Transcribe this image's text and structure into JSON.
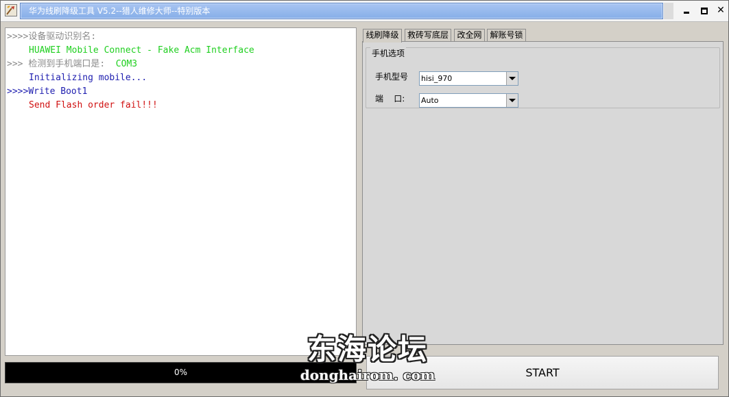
{
  "window": {
    "title": "华为线刷降级工具 V5.2--猎人维修大师--特别版本"
  },
  "log": {
    "lines": [
      {
        "prefix": ">>>>",
        "text": "设备驱动识别名:"
      },
      {
        "text": "HUAWEI Mobile Connect - Fake Acm Interface"
      },
      {
        "prefix": ">>> ",
        "text": "检测到手机端口是:",
        "value": "COM3"
      },
      {
        "text": "Initializing mobile..."
      },
      {
        "prefix": ">>>>",
        "text": "Write Boot1"
      },
      {
        "text": "Send Flash order fail!!!"
      }
    ]
  },
  "progress": {
    "label": "0%",
    "value": 0
  },
  "tabs": [
    {
      "label": "线刷降级"
    },
    {
      "label": "救砖写底层"
    },
    {
      "label": "改全网"
    },
    {
      "label": "解账号锁"
    }
  ],
  "phone_options": {
    "group_title": "手机选项",
    "model_label": "手机型号",
    "model_value": "hisi_970",
    "port_label": "端    口:",
    "port_value": "Auto"
  },
  "start_button": {
    "label": "START"
  },
  "watermark": {
    "cn": "东海论坛",
    "en": "donghairom. com"
  },
  "colors": {
    "log_gray": "#8a8a8a",
    "log_green": "#1fcf1f",
    "log_blue": "#2020b0",
    "log_red": "#d01010",
    "title_bar": "#86aee8"
  }
}
